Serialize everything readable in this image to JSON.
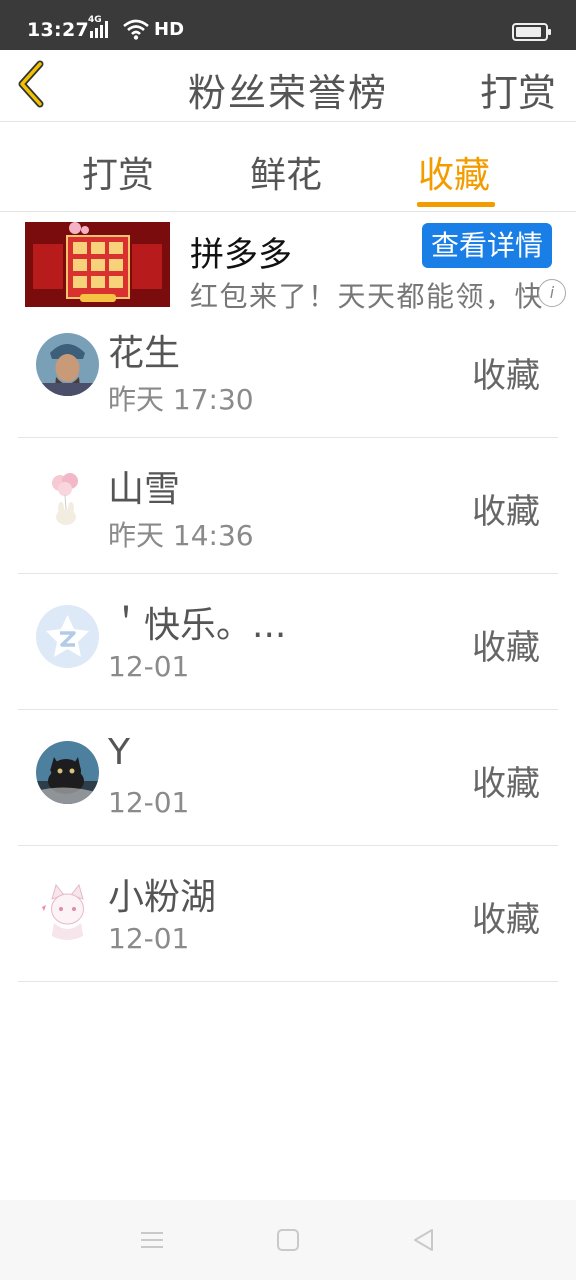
{
  "status_bar": {
    "time": "13:27",
    "network": "4G",
    "hd": "HD",
    "battery_level": 0.9
  },
  "header": {
    "title": "粉丝荣誉榜",
    "back_icon": "chevron-left-icon",
    "right_action": "打赏"
  },
  "tabs": [
    {
      "label": "打赏",
      "active": false
    },
    {
      "label": "鲜花",
      "active": false
    },
    {
      "label": "收藏",
      "active": true
    }
  ],
  "ad": {
    "title": "拼多多",
    "button_label": "查看详情",
    "description": "红包来了！天天都能领，快",
    "info_icon": "info-icon"
  },
  "fans": [
    {
      "name": "花生",
      "time": "昨天 17:30",
      "action": "收藏",
      "avatar": "warrior-avatar"
    },
    {
      "name": "山雪",
      "time": "昨天 14:36",
      "action": "收藏",
      "avatar": "balloon-bunny-avatar"
    },
    {
      "name": "＇快乐。...",
      "time": "12-01",
      "action": "收藏",
      "avatar": "qq-default-avatar"
    },
    {
      "name": "Y",
      "time": "12-01",
      "action": "收藏",
      "avatar": "black-cat-avatar"
    },
    {
      "name": "小粉湖",
      "time": "12-01",
      "action": "收藏",
      "avatar": "anime-cat-girl-avatar"
    }
  ],
  "colors": {
    "accent": "#f39c00",
    "ad_button": "#1a7ee7",
    "status_bar": "#3a3a3a"
  },
  "nav": {
    "menu_icon": "menu-icon",
    "home_icon": "home-square-icon",
    "back_icon": "back-triangle-icon"
  }
}
